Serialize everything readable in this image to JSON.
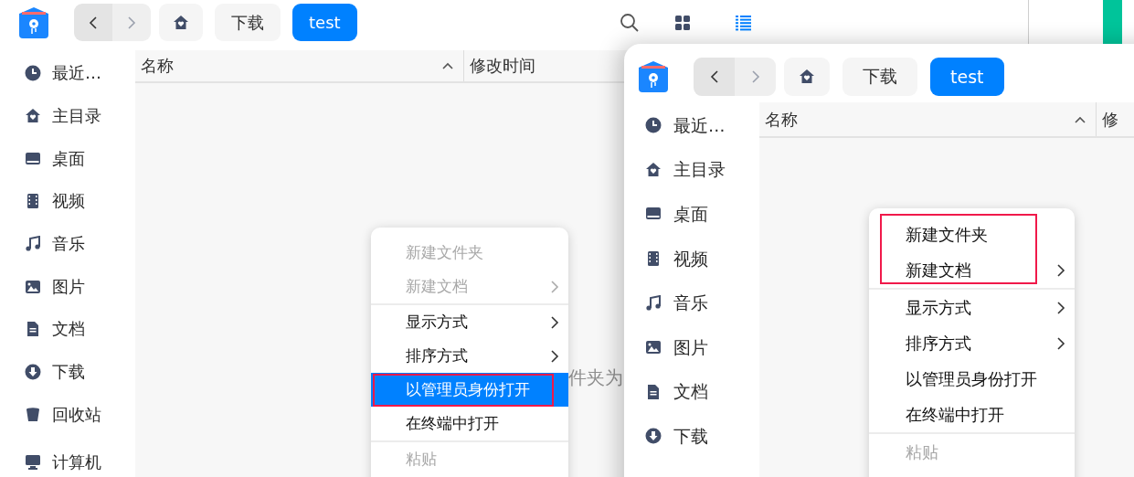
{
  "windows": [
    {
      "toolbar": {
        "back": {
          "disabled": false
        },
        "forward": {
          "disabled": true
        },
        "breadcrumbs": [
          {
            "label": "下载",
            "selected": false
          },
          {
            "label": "test",
            "selected": true
          }
        ],
        "view_modes": [
          {
            "kind": "icons",
            "selected": false
          },
          {
            "kind": "list",
            "selected": true
          }
        ]
      },
      "sidebar": {
        "items": [
          {
            "kind": "recent",
            "label": "最近…"
          },
          {
            "kind": "home",
            "label": "主目录"
          },
          {
            "kind": "desktop",
            "label": "桌面"
          },
          {
            "kind": "video",
            "label": "视频"
          },
          {
            "kind": "music",
            "label": "音乐"
          },
          {
            "kind": "pictures",
            "label": "图片"
          },
          {
            "kind": "documents",
            "label": "文档"
          },
          {
            "kind": "downloads",
            "label": "下载"
          },
          {
            "kind": "trash",
            "label": "回收站"
          },
          {
            "kind": "separator"
          },
          {
            "kind": "computer",
            "label": "计算机"
          }
        ]
      },
      "table": {
        "columns": [
          {
            "label": "名称",
            "sorted": true
          },
          {
            "label": "修改时间",
            "sorted": false
          }
        ]
      },
      "empty_message": "件夹为",
      "context_menu": {
        "groups": [
          {
            "items": [
              {
                "label": "新建文件夹",
                "disabled": true,
                "submenu": false,
                "selected": false,
                "annotated": false
              },
              {
                "label": "新建文档",
                "disabled": true,
                "submenu": true,
                "selected": false,
                "annotated": false
              }
            ]
          },
          {
            "items": [
              {
                "label": "显示方式",
                "disabled": false,
                "submenu": true,
                "selected": false,
                "annotated": false
              },
              {
                "label": "排序方式",
                "disabled": false,
                "submenu": true,
                "selected": false,
                "annotated": false
              },
              {
                "label": "以管理员身份打开",
                "disabled": false,
                "submenu": false,
                "selected": true,
                "annotated": true
              },
              {
                "label": "在终端中打开",
                "disabled": false,
                "submenu": false,
                "selected": false,
                "annotated": false
              }
            ]
          },
          {
            "items": [
              {
                "label": "粘贴",
                "disabled": true,
                "submenu": false,
                "selected": false,
                "annotated": false
              }
            ]
          }
        ]
      }
    },
    {
      "toolbar": {
        "back": {
          "disabled": false
        },
        "forward": {
          "disabled": true
        },
        "breadcrumbs": [
          {
            "label": "下载",
            "selected": false
          },
          {
            "label": "test",
            "selected": true
          }
        ]
      },
      "sidebar": {
        "items": [
          {
            "kind": "recent",
            "label": "最近…"
          },
          {
            "kind": "home",
            "label": "主目录"
          },
          {
            "kind": "desktop",
            "label": "桌面"
          },
          {
            "kind": "video",
            "label": "视频"
          },
          {
            "kind": "music",
            "label": "音乐"
          },
          {
            "kind": "pictures",
            "label": "图片"
          },
          {
            "kind": "documents",
            "label": "文档"
          },
          {
            "kind": "downloads",
            "label": "下载"
          }
        ]
      },
      "table": {
        "columns": [
          {
            "label": "名称",
            "sorted": true
          },
          {
            "label": "修",
            "sorted": false
          }
        ]
      },
      "context_menu": {
        "groups": [
          {
            "items": [
              {
                "label": "新建文件夹",
                "disabled": false,
                "submenu": false,
                "selected": false,
                "annotated": true
              },
              {
                "label": "新建文档",
                "disabled": false,
                "submenu": true,
                "selected": false,
                "annotated": true
              }
            ]
          },
          {
            "items": [
              {
                "label": "显示方式",
                "disabled": false,
                "submenu": true,
                "selected": false,
                "annotated": false
              },
              {
                "label": "排序方式",
                "disabled": false,
                "submenu": true,
                "selected": false,
                "annotated": false
              },
              {
                "label": "以管理员身份打开",
                "disabled": false,
                "submenu": false,
                "selected": false,
                "annotated": false
              },
              {
                "label": "在终端中打开",
                "disabled": false,
                "submenu": false,
                "selected": false,
                "annotated": false
              }
            ]
          },
          {
            "items": [
              {
                "label": "粘贴",
                "disabled": true,
                "submenu": false,
                "selected": false,
                "annotated": false
              }
            ]
          }
        ]
      }
    }
  ]
}
